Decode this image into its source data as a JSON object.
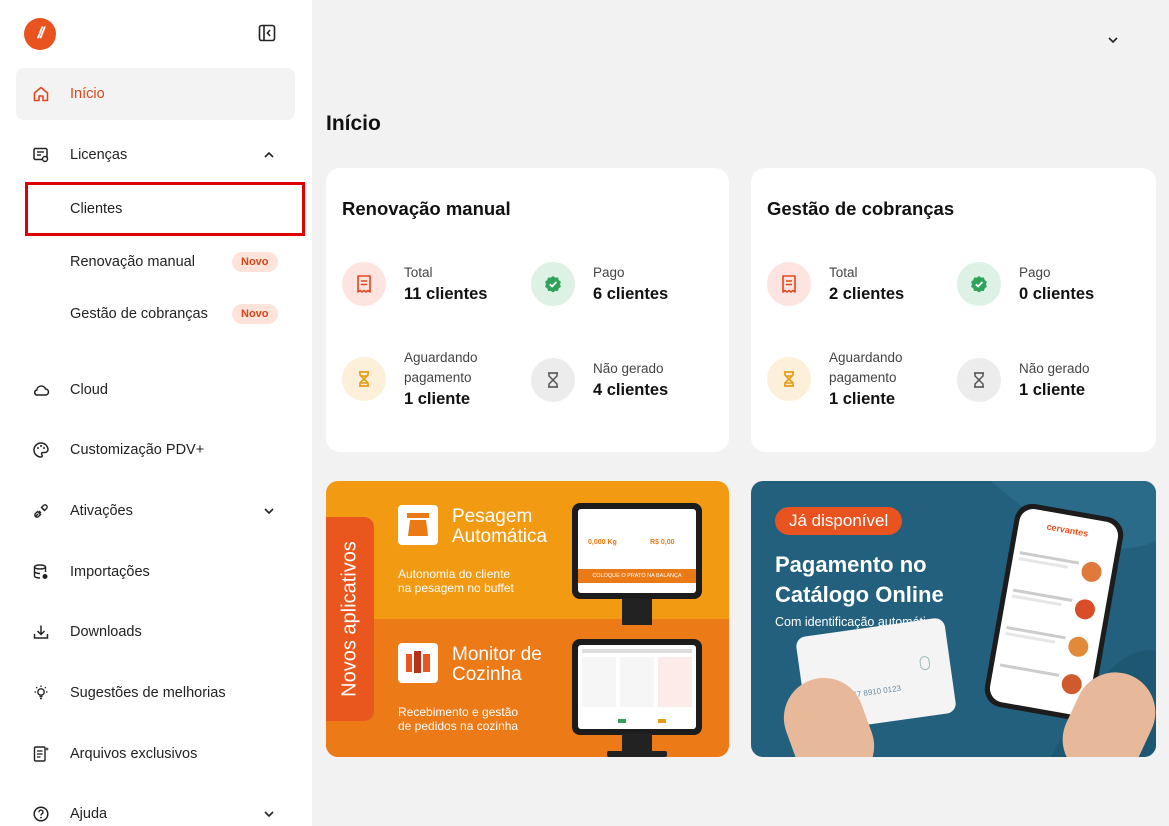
{
  "sidebar": {
    "logo_text": "//",
    "items": [
      {
        "label": "Início",
        "icon": "home-icon"
      },
      {
        "label": "Licenças",
        "icon": "license-icon"
      },
      {
        "label": "Cloud",
        "icon": "cloud-icon"
      },
      {
        "label": "Customização PDV+",
        "icon": "palette-icon"
      },
      {
        "label": "Ativações",
        "icon": "plug-icon"
      },
      {
        "label": "Importações",
        "icon": "database-import-icon"
      },
      {
        "label": "Downloads",
        "icon": "download-icon"
      },
      {
        "label": "Sugestões de melhorias",
        "icon": "lightbulb-icon"
      },
      {
        "label": "Arquivos exclusivos",
        "icon": "exclusive-file-icon"
      },
      {
        "label": "Ajuda",
        "icon": "help-icon"
      }
    ],
    "sub_items": [
      {
        "label": "Clientes"
      },
      {
        "label": "Renovação manual",
        "badge": "Novo"
      },
      {
        "label": "Gestão de cobranças",
        "badge": "Novo"
      }
    ]
  },
  "main": {
    "title": "Início",
    "cards": [
      {
        "title": "Renovação manual",
        "stats": [
          {
            "label": "Total",
            "value": "11 clientes",
            "icon": "receipt-icon",
            "color": "#e2461b"
          },
          {
            "label": "Pago",
            "value": "6 clientes",
            "icon": "check-badge-icon",
            "color": "#2fa35a"
          },
          {
            "label_line1": "Aguardando",
            "label_line2": "pagamento",
            "value": "1 cliente",
            "icon": "hourglass-icon",
            "color": "#e59a12"
          },
          {
            "label": "Não gerado",
            "value": "4 clientes",
            "icon": "hourglass-empty-icon",
            "color": "#555555"
          }
        ]
      },
      {
        "title": "Gestão de cobranças",
        "stats": [
          {
            "label": "Total",
            "value": "2 clientes",
            "icon": "receipt-icon",
            "color": "#e2461b"
          },
          {
            "label": "Pago",
            "value": "0 clientes",
            "icon": "check-badge-icon",
            "color": "#2fa35a"
          },
          {
            "label_line1": "Aguardando",
            "label_line2": "pagamento",
            "value": "1 cliente",
            "icon": "hourglass-icon",
            "color": "#e59a12"
          },
          {
            "label": "Não gerado",
            "value": "1 cliente",
            "icon": "hourglass-empty-icon",
            "color": "#555555"
          }
        ]
      }
    ],
    "banner_left": {
      "tab_label": "Novos aplicativos",
      "app1_title_1": "Pesagem",
      "app1_title_2": "Automática",
      "app1_sub_1": "Autonomia do cliente",
      "app1_sub_2": "na pesagem no buffet",
      "app1_screen_kg": "0,000 Kg",
      "app1_screen_rs": "R$ 0,00",
      "app1_screen_footer": "COLOQUE O PRATO NA BALANÇA",
      "app2_title_1": "Monitor de",
      "app2_title_2": "Cozinha",
      "app2_sub_1": "Recebimento e gestão",
      "app2_sub_2": "de pedidos na cozinha"
    },
    "banner_right": {
      "pill": "Já disponível",
      "title_1": "Pagamento no",
      "title_2": "Catálogo Online",
      "subtitle": "Com identificação automática",
      "card_number": "4567 8910 0123",
      "phone_brand": "cervantes"
    }
  }
}
